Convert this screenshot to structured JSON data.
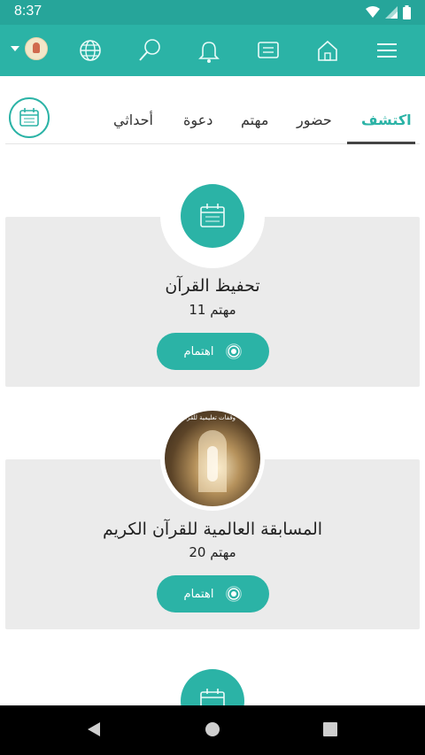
{
  "status": {
    "time": "8:37"
  },
  "tabs": [
    {
      "label": "اكتشف",
      "active": true
    },
    {
      "label": "حضور"
    },
    {
      "label": "مهتم"
    },
    {
      "label": "دعوة"
    },
    {
      "label": "أحداثي"
    }
  ],
  "events": [
    {
      "title": "تحفيظ القرآن",
      "interested": "11 مهتم",
      "button": "اهتمام",
      "thumb": "calendar-icon"
    },
    {
      "title": "المسابقة العالمية للقرآن الكريم",
      "interested": "20 مهتم",
      "button": "اهتمام",
      "thumb": "photo",
      "photo_caption": "وقفات تعليمية للقرآن"
    }
  ],
  "colors": {
    "accent": "#2bb3a6",
    "status_bar": "#26a59a",
    "card": "#ebebeb"
  }
}
